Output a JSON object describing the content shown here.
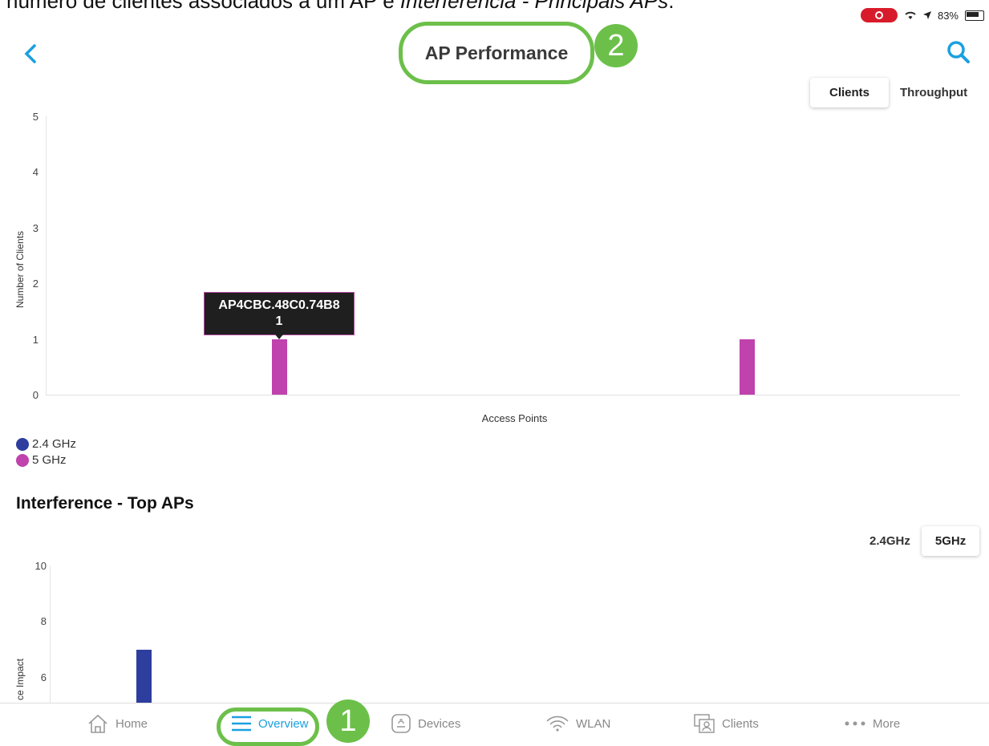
{
  "caption": {
    "prefix": "número de clientes associados a um AP e ",
    "italic": "Interferência - Principais APs",
    "suffix": "."
  },
  "status": {
    "battery": "83%"
  },
  "header": {
    "title": "AP Performance",
    "step_title": "2"
  },
  "clients_toggle": {
    "options": [
      "Clients",
      "Throughput"
    ],
    "active": "Clients"
  },
  "chart_data": [
    {
      "type": "bar",
      "ylabel": "Number of Clients",
      "xlabel": "Access Points",
      "ylim": [
        0,
        5
      ],
      "yticks": [
        "5",
        "4",
        "3",
        "2",
        "1",
        "0"
      ],
      "categories": [
        "AP4CBC.48C0.74B8",
        ""
      ],
      "series": [
        {
          "name": "2.4 GHz",
          "color": "#2d3e9e",
          "values": [
            0,
            0
          ]
        },
        {
          "name": "5 GHz",
          "color": "#c042ad",
          "values": [
            1,
            1
          ]
        }
      ],
      "tooltip": {
        "label": "AP4CBC.48C0.74B8",
        "value": "1"
      },
      "legend": "bottom-left"
    },
    {
      "type": "bar",
      "title": "Interference - Top APs",
      "ylabel": "ce Impact",
      "ylim": [
        5,
        10
      ],
      "yticks": [
        "10",
        "8",
        "6"
      ],
      "series": [
        {
          "color": "#2d3e9e",
          "values": [
            7
          ]
        }
      ]
    }
  ],
  "interference": {
    "title": "Interference - Top APs",
    "band_toggle": {
      "options": [
        "2.4GHz",
        "5GHz"
      ],
      "active": "5GHz"
    }
  },
  "nav": {
    "items": [
      {
        "label": "Home",
        "icon": "home-icon"
      },
      {
        "label": "Overview",
        "icon": "menu-icon",
        "active": true
      },
      {
        "label": "Devices",
        "icon": "devices-icon"
      },
      {
        "label": "WLAN",
        "icon": "wifi-icon"
      },
      {
        "label": "Clients",
        "icon": "clients-icon"
      },
      {
        "label": "More",
        "icon": "more-icon"
      }
    ],
    "step_overview": "1"
  },
  "colors": {
    "accent": "#1aa0e0",
    "highlight": "#6cc04a",
    "band_24": "#2d3e9e",
    "band_5": "#c042ad"
  }
}
